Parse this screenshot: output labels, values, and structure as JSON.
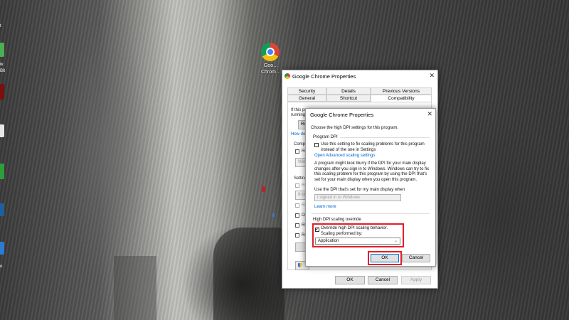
{
  "desktop": {
    "shortcut_label_line1": "Goo…",
    "shortcut_label_line2": "Chrom…",
    "left_strip_text": [
      "t",
      "w",
      "Bit",
      "o"
    ]
  },
  "colors": {
    "highlight_red": "#e0202a",
    "link_blue": "#0066cc"
  },
  "properties_window": {
    "title": "Google Chrome Properties",
    "close_glyph": "✕",
    "tabs_row1": [
      "Security",
      "Details",
      "Previous Versions"
    ],
    "tabs_row2": [
      "General",
      "Shortcut",
      "Compatibility"
    ],
    "active_tab": "Compatibility",
    "panel_fragments": [
      "If this pr",
      "running fr",
      "Run",
      "How do",
      "Compa",
      "Ru",
      "Windo",
      "Setting",
      "Re",
      "8-bit",
      "Ru",
      "Dis",
      "Ru",
      "Re"
    ],
    "ok_label": "OK",
    "cancel_label": "Cancel",
    "apply_label": "Apply"
  },
  "dpi_dialog": {
    "title": "Google Chrome Properties",
    "close_glyph": "✕",
    "intro": "Choose the high DPI settings for this program.",
    "program_dpi": {
      "heading": "Program DPI",
      "checkbox_line1": "Use this setting to fix scaling problems for this program",
      "checkbox_line2": "instead of the one in Settings",
      "checked": false,
      "link": "Open Advanced scaling settings",
      "desc_lines": [
        "A program might look blurry if the DPI for your main display",
        "changes after you sign in to Windows. Windows can try to fix",
        "this scaling problem for this program by using the DPI that's",
        "set for your main display when you open this program."
      ],
      "use_dpi_label": "Use the DPI that's set for my main display when",
      "dropdown_value": "I signed in to Windows",
      "learn_more": "Learn more"
    },
    "override": {
      "heading": "High DPI scaling override",
      "checkbox_line1": "Override high DPI scaling behavior.",
      "checkbox_line2": "Scaling performed by:",
      "checked": true,
      "dropdown_value": "Application"
    },
    "ok_label": "OK",
    "cancel_label": "Cancel"
  }
}
